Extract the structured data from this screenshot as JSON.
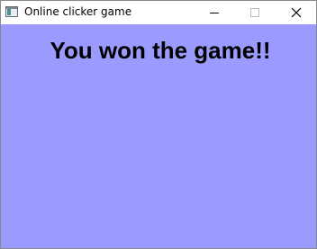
{
  "window": {
    "title": "Online clicker game",
    "icon": "app-window-icon",
    "controls": {
      "minimize_icon": "minimize-icon",
      "maximize_icon": "maximize-icon",
      "close_icon": "close-icon"
    }
  },
  "content": {
    "message": "You won the game!!"
  },
  "colors": {
    "background": "#9b9bff",
    "titlebar": "#ffffff",
    "text": "#000000"
  }
}
